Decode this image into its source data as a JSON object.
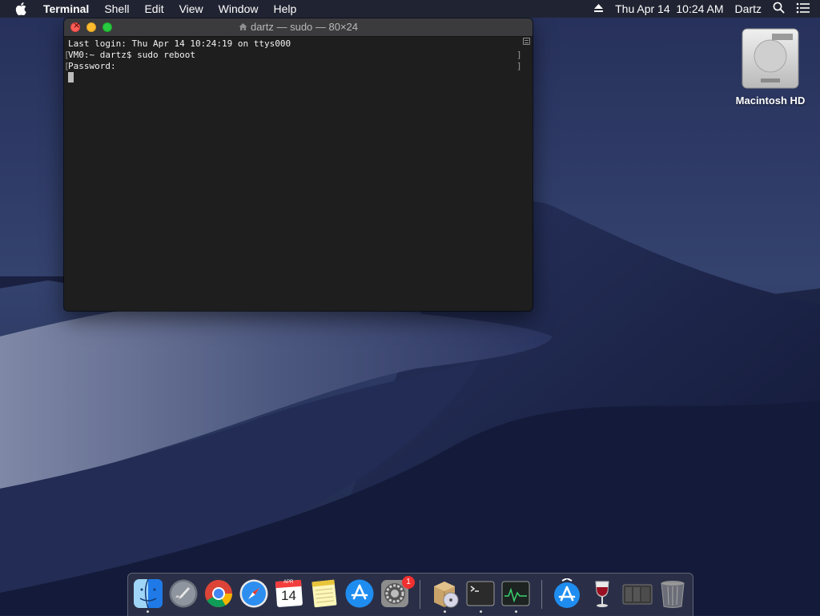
{
  "menubar": {
    "app_name": "Terminal",
    "menus": [
      "Shell",
      "Edit",
      "View",
      "Window",
      "Help"
    ],
    "datetime": "Thu Apr 14  10:24 AM",
    "user": "Dartz"
  },
  "desktop": {
    "drive_label": "Macintosh HD"
  },
  "terminal": {
    "title": "dartz — sudo — 80×24",
    "lines": [
      "Last login: Thu Apr 14 10:24:19 on ttys000",
      "VM0:~ dartz$ sudo reboot",
      "Password:"
    ]
  },
  "dock": {
    "items": [
      {
        "name": "finder-icon",
        "running": true
      },
      {
        "name": "launchpad-icon",
        "running": false
      },
      {
        "name": "chrome-icon",
        "running": false
      },
      {
        "name": "safari-icon",
        "running": false
      },
      {
        "name": "calendar-icon",
        "running": false
      },
      {
        "name": "notes-icon",
        "running": false
      },
      {
        "name": "app-store-icon",
        "running": false
      },
      {
        "name": "system-preferences-icon",
        "running": false,
        "badge": "1"
      },
      {
        "name": "installer-icon",
        "running": true
      },
      {
        "name": "terminal-icon",
        "running": true
      },
      {
        "name": "activity-monitor-icon",
        "running": true
      },
      {
        "name": "app-store-download-icon",
        "running": false
      },
      {
        "name": "wine-icon",
        "running": false
      },
      {
        "name": "hardware-icon",
        "running": false
      },
      {
        "name": "trash-icon",
        "running": false
      }
    ],
    "calendar_month": "APR",
    "calendar_day": "14"
  }
}
